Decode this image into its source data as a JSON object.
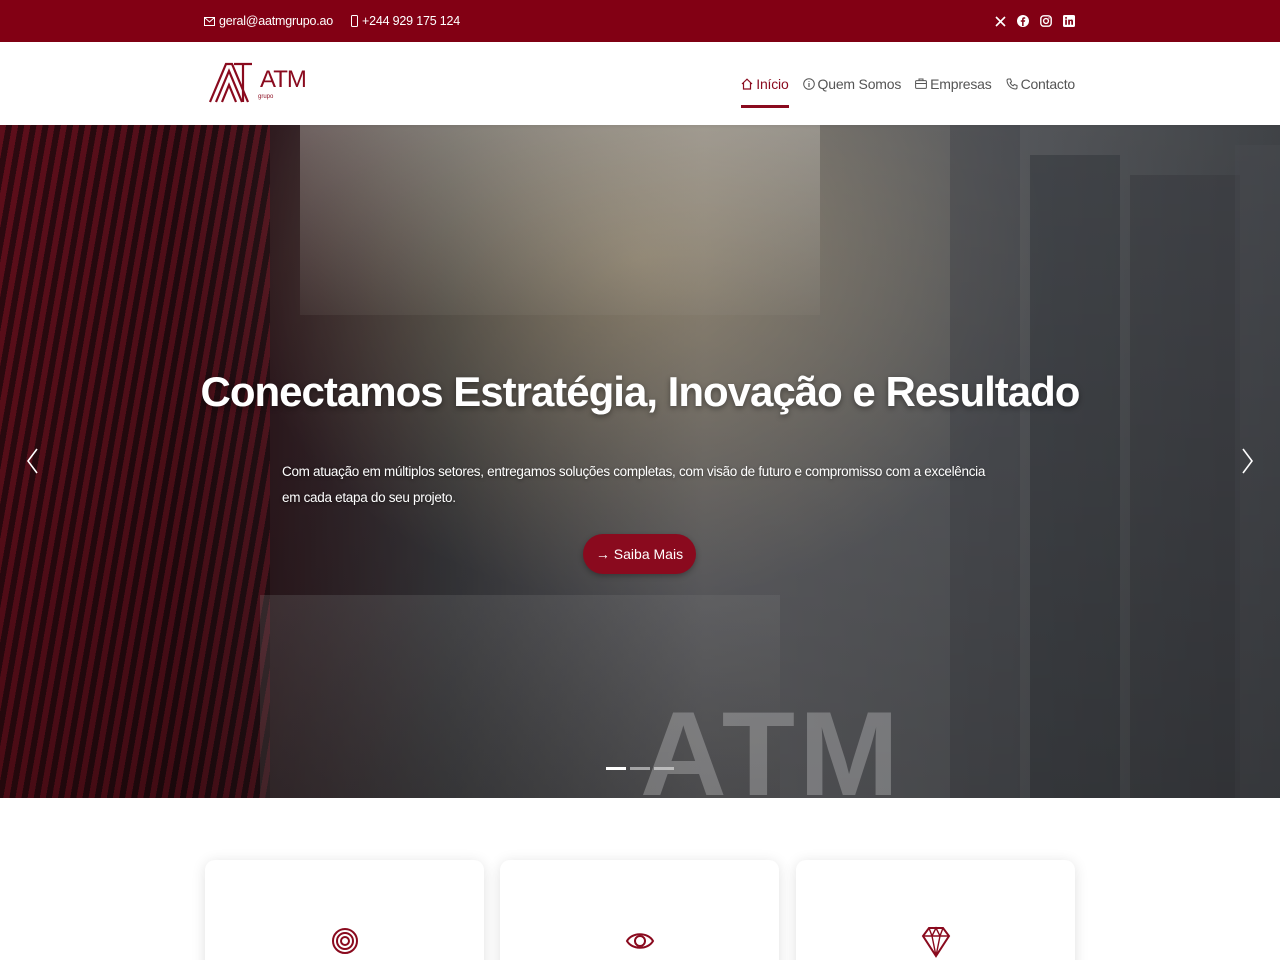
{
  "topbar": {
    "email": "geral@aatmgrupo.ao",
    "phone": "+244 929 175 124",
    "social": [
      "x-icon",
      "facebook-icon",
      "instagram-icon",
      "linkedin-icon"
    ]
  },
  "brand": {
    "name": "ATM",
    "tagline": "grupo",
    "color": "#8a0a1e"
  },
  "nav": {
    "items": [
      {
        "label": "Início",
        "icon": "home-icon",
        "active": true
      },
      {
        "label": "Quem Somos",
        "icon": "info-icon",
        "active": false
      },
      {
        "label": "Empresas",
        "icon": "briefcase-icon",
        "active": false
      },
      {
        "label": "Contacto",
        "icon": "phone-icon",
        "active": false
      }
    ]
  },
  "hero": {
    "title": "Conectamos Estratégia, Inovação e Resultado",
    "subtitle": "Com atuação em múltiplos setores, entregamos soluções completas, com visão de futuro e compromisso com a excelência em cada etapa do seu projeto.",
    "cta_label": "→ Saiba Mais",
    "watermark": "ATM",
    "slides": 3,
    "active_slide": 1
  },
  "cards": [
    {
      "icon": "target-icon"
    },
    {
      "icon": "eye-icon"
    },
    {
      "icon": "diamond-icon"
    }
  ],
  "colors": {
    "primary": "#820014",
    "accent": "#8a0a1e"
  }
}
